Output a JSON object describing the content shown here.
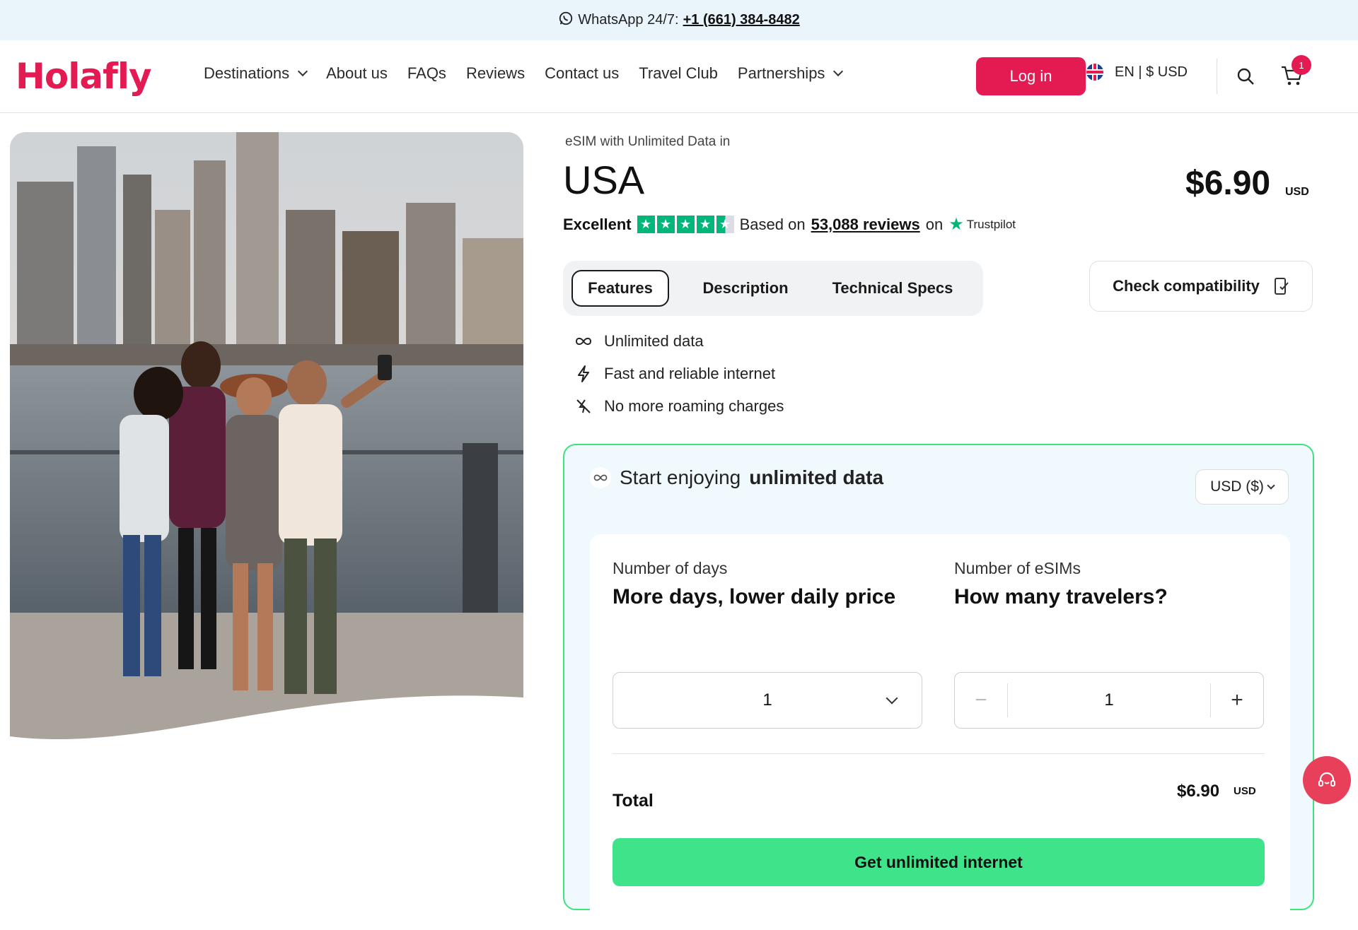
{
  "topbar": {
    "label": "WhatsApp 24/7:",
    "phone": "+1 (661) 384-8482"
  },
  "header": {
    "logo": "Holafly",
    "nav": [
      {
        "label": "Destinations",
        "dropdown": true
      },
      {
        "label": "About us"
      },
      {
        "label": "FAQs"
      },
      {
        "label": "Reviews"
      },
      {
        "label": "Contact us"
      },
      {
        "label": "Travel Club"
      },
      {
        "label": "Partnerships",
        "dropdown": true
      }
    ],
    "login_label": "Log in",
    "lang_currency": "EN | $ USD",
    "cart_count": "1"
  },
  "product": {
    "subtitle": "eSIM with Unlimited Data in",
    "country": "USA",
    "price": "$6.90",
    "currency": "USD"
  },
  "rating": {
    "label": "Excellent",
    "based_on": "Based on",
    "reviews": "53,088 reviews",
    "on": "on",
    "provider": "Trustpilot"
  },
  "tabs": [
    "Features",
    "Description",
    "Technical Specs"
  ],
  "compat_label": "Check compatibility",
  "features": [
    "Unlimited data",
    "Fast and reliable internet",
    "No more roaming charges"
  ],
  "panel": {
    "heading_prefix": "Start enjoying",
    "heading_bold": "unlimited data",
    "currency_select": "USD ($)",
    "days_label": "Number of days",
    "days_heading": "More days, lower daily price",
    "days_value": "1",
    "esims_label": "Number of eSIMs",
    "esims_heading": "How many travelers?",
    "esims_value": "1",
    "minus": "−",
    "plus": "+",
    "total_label": "Total",
    "total_value": "$6.90",
    "total_currency": "USD",
    "cta_label": "Get unlimited internet"
  },
  "colors": {
    "brand": "#e31b52",
    "accent_green": "#3fe48a",
    "trustpilot": "#00b67a"
  }
}
